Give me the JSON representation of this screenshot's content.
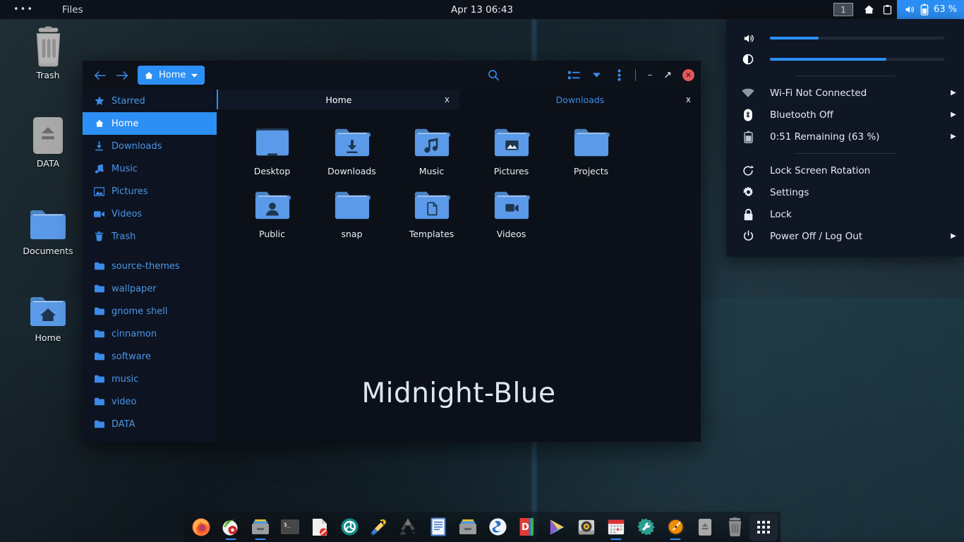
{
  "topbar": {
    "menu_dots": "•••",
    "app_name": "Files",
    "clock": "Apr 13  06:43",
    "workspace": "1",
    "home_icon": "home-icon",
    "clipboard_icon": "clipboard-icon",
    "volume_icon": "volume-icon",
    "battery_icon": "battery-icon",
    "battery_percent": "63 %"
  },
  "desktop_icons": [
    {
      "label": "Trash",
      "icon": "trash-icon"
    },
    {
      "label": "DATA",
      "icon": "drive-eject-icon"
    },
    {
      "label": "Documents",
      "icon": "folder-icon"
    },
    {
      "label": "Home",
      "icon": "folder-home-icon"
    }
  ],
  "window": {
    "back_icon": "arrow-left-icon",
    "forward_icon": "arrow-right-icon",
    "path_label": "Home",
    "path_icon": "home-icon",
    "path_chevron": "chevron-down-icon",
    "search_icon": "search-icon",
    "viewmode_icon": "list-view-icon",
    "viewmode_chevron": "chevron-down-icon",
    "menu_icon": "kebab-menu-icon",
    "minimize_label": "–",
    "maximize_label": "⤡",
    "close_label": "✕",
    "watermark": "Midnight-Blue",
    "tabs": [
      {
        "label": "Home",
        "close": "x",
        "active": true
      },
      {
        "label": "Downloads",
        "close": "x",
        "active": false
      }
    ],
    "sidebar": [
      {
        "label": "Starred",
        "icon": "star-icon",
        "active": false
      },
      {
        "label": "Home",
        "icon": "home-icon",
        "active": true
      },
      {
        "label": "Downloads",
        "icon": "download-icon",
        "active": false
      },
      {
        "label": "Music",
        "icon": "music-note-icon",
        "active": false
      },
      {
        "label": "Pictures",
        "icon": "picture-icon",
        "active": false
      },
      {
        "label": "Videos",
        "icon": "video-camera-icon",
        "active": false
      },
      {
        "label": "Trash",
        "icon": "trash-icon",
        "active": false
      }
    ],
    "sidebar_bookmarks": [
      {
        "label": "source-themes",
        "icon": "folder-icon"
      },
      {
        "label": "wallpaper",
        "icon": "folder-icon"
      },
      {
        "label": "gnome shell",
        "icon": "folder-icon"
      },
      {
        "label": "cinnamon",
        "icon": "folder-icon"
      },
      {
        "label": "software",
        "icon": "folder-icon"
      },
      {
        "label": "music",
        "icon": "folder-icon"
      },
      {
        "label": "video",
        "icon": "folder-icon"
      },
      {
        "label": "DATA",
        "icon": "folder-icon"
      }
    ],
    "files": [
      {
        "label": "Desktop",
        "icon": "folder-desktop-icon"
      },
      {
        "label": "Downloads",
        "icon": "folder-download-icon"
      },
      {
        "label": "Music",
        "icon": "folder-music-icon"
      },
      {
        "label": "Pictures",
        "icon": "folder-pictures-icon"
      },
      {
        "label": "Projects",
        "icon": "folder-icon"
      },
      {
        "label": "Public",
        "icon": "folder-public-icon"
      },
      {
        "label": "snap",
        "icon": "folder-icon"
      },
      {
        "label": "Templates",
        "icon": "folder-templates-icon"
      },
      {
        "label": "Videos",
        "icon": "folder-videos-icon"
      }
    ]
  },
  "sysmenu": {
    "volume": {
      "icon": "volume-icon",
      "value": 28
    },
    "brightness": {
      "icon": "brightness-icon",
      "value": 67
    },
    "items": [
      {
        "label": "Wi-Fi Not Connected",
        "icon": "wifi-icon",
        "chevron": "▶"
      },
      {
        "label": "Bluetooth Off",
        "icon": "bluetooth-icon",
        "chevron": "▶"
      },
      {
        "label": "0:51 Remaining (63 %)",
        "icon": "battery-icon",
        "chevron": "▶"
      },
      {
        "label": "Lock Screen Rotation",
        "icon": "rotation-lock-icon",
        "chevron": ""
      },
      {
        "label": "Settings",
        "icon": "gear-icon",
        "chevron": ""
      },
      {
        "label": "Lock",
        "icon": "lock-icon",
        "chevron": ""
      },
      {
        "label": "Power Off / Log Out",
        "icon": "power-icon",
        "chevron": "▶"
      }
    ]
  },
  "dock": [
    {
      "name": "firefox",
      "running": false
    },
    {
      "name": "gparted",
      "running": true
    },
    {
      "name": "file-manager-nemo",
      "running": true
    },
    {
      "name": "terminal",
      "running": false
    },
    {
      "name": "text-editor",
      "running": false
    },
    {
      "name": "shutter",
      "running": false
    },
    {
      "name": "color-picker",
      "running": false
    },
    {
      "name": "inkscape",
      "running": false
    },
    {
      "name": "libreoffice-writer",
      "running": false
    },
    {
      "name": "file-manager-nautilus",
      "running": false
    },
    {
      "name": "smplayer",
      "running": false
    },
    {
      "name": "dictionary",
      "running": false
    },
    {
      "name": "media-player",
      "running": false
    },
    {
      "name": "disk-utility",
      "running": false
    },
    {
      "name": "calendar",
      "running": true
    },
    {
      "name": "tweak-tool",
      "running": false
    },
    {
      "name": "clock",
      "running": true
    },
    {
      "name": "usb-eject",
      "running": false
    },
    {
      "name": "trash",
      "running": false
    },
    {
      "name": "app-grid",
      "running": false
    }
  ],
  "colors": {
    "accent": "#2b8ff5",
    "window_bg": "#0c1018",
    "sidebar_bg": "#0d1320",
    "topbar_bg": "#0d1119",
    "close_red": "#e2585c",
    "folder_blue": "#5a9ae8"
  }
}
